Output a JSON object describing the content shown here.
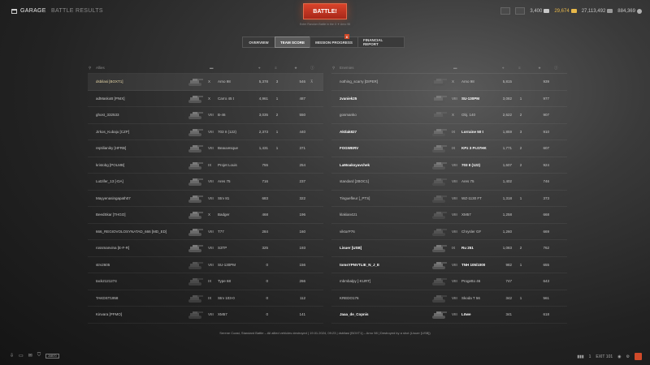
{
  "header": {
    "garage": "GARAGE",
    "battle_results": "BATTLE RESULTS",
    "battle_button": "BATTLE!",
    "battle_sub": "Enter Random Battle in the X ✦ Arno 98",
    "credits": "3,400",
    "gold": "29,674",
    "free_xp": "27,113,492",
    "bonds": "884,369"
  },
  "tabs": [
    {
      "label": "OVERVIEW"
    },
    {
      "label": "TEAM SCORE"
    },
    {
      "label": "MISSION PROGRESS"
    },
    {
      "label": "FINANCIAL REPORT"
    }
  ],
  "mission_badge": "6",
  "allies": {
    "title": "Allies",
    "rows": [
      {
        "name": "dsbilasi [BOXT1]",
        "tier": "X",
        "tank": "Arno 98",
        "dmg": "5,378",
        "kills": "3",
        "xp": "546",
        "player": true
      },
      {
        "name": "adMaskoB [PNIX]",
        "tier": "X",
        "tank": "Carro 45 t",
        "dmg": "4,961",
        "kills": "1",
        "xp": "487"
      },
      {
        "name": "ghost_332533",
        "tier": "VIII",
        "tank": "B-46",
        "dmg": "3,035",
        "kills": "2",
        "xp": "550"
      },
      {
        "name": "Jirkos_Kubaju [CZP]",
        "tier": "VIII",
        "tank": "703 II (122)",
        "dmg": "2,373",
        "kills": "1",
        "xp": "440"
      },
      {
        "name": "reptilianiky [HFRB]",
        "tier": "VIII",
        "tank": "Beauvesque",
        "dmg": "1,431",
        "kills": "1",
        "xp": "371"
      },
      {
        "name": "kristobg [POLMB]",
        "tier": "IX",
        "tank": "Projet Louis",
        "dmg": "755",
        "kills": "",
        "xp": "254"
      },
      {
        "name": "Lutzifer_13 [-DA]",
        "tier": "VIII",
        "tank": "Ares 75",
        "dmg": "716",
        "kills": "",
        "xp": "237"
      },
      {
        "name": "Mayyenasingapath07",
        "tier": "VIII",
        "tank": "Strv 81",
        "dmg": "683",
        "kills": "",
        "xp": "322"
      },
      {
        "name": "BeedSkar [THGO]",
        "tier": "X",
        "tank": "Badger",
        "dmg": "468",
        "kills": "",
        "xp": "196"
      },
      {
        "name": "666_REGIOVOLOSYNATAD_666 [MD_ED]",
        "tier": "VIII",
        "tank": "T77",
        "dmg": "284",
        "kills": "",
        "xp": "160"
      },
      {
        "name": "rossmanvina [E-F-R]",
        "tier": "VIII",
        "tank": "S3TP",
        "dmg": "325",
        "kills": "",
        "xp": "193"
      },
      {
        "name": "strv2605",
        "tier": "VIII",
        "tank": "SU-130PM",
        "dmg": "0",
        "kills": "",
        "xp": "156"
      },
      {
        "name": "tack2121274",
        "tier": "IX",
        "tank": "Type 68",
        "dmg": "0",
        "kills": "",
        "xp": "266"
      },
      {
        "name": "TAKDST1958",
        "tier": "IX",
        "tank": "Strv 103-0",
        "dmg": "0",
        "kills": "",
        "xp": "112"
      },
      {
        "name": "Kinvara [PFMO]",
        "tier": "VIII",
        "tank": "XM57",
        "dmg": "0",
        "kills": "",
        "xp": "141"
      }
    ]
  },
  "enemies": {
    "title": "Enemies",
    "rows": [
      {
        "name": "nothing_scarry [DIPER]",
        "tier": "X",
        "tank": "Arno 98",
        "dmg": "5,815",
        "kills": "",
        "xp": "939",
        "dead": true
      },
      {
        "name": "zvaniek25",
        "tier": "VIII",
        "tank": "SU-130PM",
        "dmg": "3,082",
        "kills": "1",
        "xp": "977"
      },
      {
        "name": "gosmanko",
        "tier": "X",
        "tank": "Obj. 140",
        "dmg": "2,622",
        "kills": "2",
        "xp": "907",
        "dead": true
      },
      {
        "name": "Aktlak827",
        "tier": "IX",
        "tank": "Lorraine 50 t",
        "dmg": "1,859",
        "kills": "3",
        "xp": "910"
      },
      {
        "name": "FOGWERV",
        "tier": "IX",
        "tank": "KPz 3 Pr.07HK",
        "dmg": "1,771",
        "kills": "2",
        "xp": "607"
      },
      {
        "name": "LaMoaksyavchek",
        "tier": "VIII",
        "tank": "703 II (122)",
        "dmg": "1,607",
        "kills": "2",
        "xp": "924"
      },
      {
        "name": "standard [2BOC1]",
        "tier": "VIII",
        "tank": "Ares 75",
        "dmg": "1,402",
        "kills": "",
        "xp": "746",
        "dead": true
      },
      {
        "name": "Tinguefleur [_PTS]",
        "tier": "VIII",
        "tank": "WZ-1130 FT",
        "dmg": "1,318",
        "kills": "1",
        "xp": "373",
        "dead": true
      },
      {
        "name": "klakian421",
        "tier": "VIII",
        "tank": "XM57",
        "dmg": "1,258",
        "kills": "",
        "xp": "668",
        "dead": true
      },
      {
        "name": "viktorP76",
        "tier": "VIII",
        "tank": "Chrysler GF",
        "dmg": "1,260",
        "kills": "",
        "xp": "669",
        "dead": true
      },
      {
        "name": "Lisuer [USB]",
        "tier": "IX",
        "tank": "Ru 251",
        "dmg": "1,083",
        "kills": "2",
        "xp": "762"
      },
      {
        "name": "tomsYPNVTLIE_N_J_E",
        "tier": "VIII",
        "tank": "TNH 105/1000",
        "dmg": "982",
        "kills": "1",
        "xp": "655"
      },
      {
        "name": "mbmbalpy [-KURT]",
        "tier": "VIII",
        "tank": "Progetto 46",
        "dmg": "747",
        "kills": "",
        "xp": "643",
        "dead": true
      },
      {
        "name": "KREDO176",
        "tier": "VIII",
        "tank": "Skoda T 56",
        "dmg": "342",
        "kills": "1",
        "xp": "561",
        "dead": true
      },
      {
        "name": "Jaaa_de_Copnis",
        "tier": "VIII",
        "tank": "Löwe",
        "dmg": "341",
        "kills": "",
        "xp": "618"
      }
    ]
  },
  "footer": "Serene Coast, Standard Battle – All allied vehicles destroyed  |  19.01.2024, 09:23  |  dsbilasi [BOXT1] – Arno 98  |  Destroyed by a shot (Lisuer [USB])",
  "bottom": {
    "chip_label": "20BT0",
    "online_count": "1",
    "fps": "EXIT 101"
  },
  "colors": {
    "battle_red": "#c0341e",
    "gold": "#e8b84a",
    "player_row": "#e8d8a8"
  }
}
